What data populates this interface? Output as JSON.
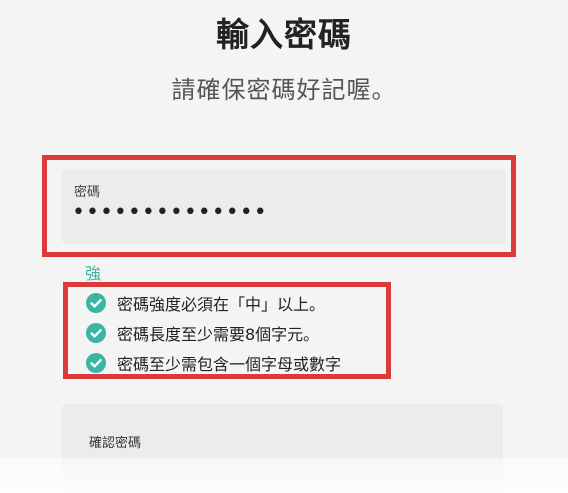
{
  "header": {
    "title": "輸入密碼",
    "subtitle": "請確保密碼好記喔。"
  },
  "password_field": {
    "label": "密碼",
    "value": "••••••••••••••"
  },
  "strength": {
    "label": "強",
    "color": "#3ab5a4"
  },
  "requirements": [
    {
      "text": "密碼強度必須在「中」以上。",
      "icon": "check-circle-icon",
      "met": true
    },
    {
      "text": "密碼長度至少需要8個字元。",
      "icon": "check-circle-icon",
      "met": true
    },
    {
      "text": "密碼至少需包含一個字母或數字",
      "icon": "check-circle-icon",
      "met": true
    }
  ],
  "confirm_field": {
    "label": "確認密碼",
    "value": ""
  },
  "colors": {
    "highlight": "#d93a3a",
    "check": "#3ab5a4",
    "field_bg": "#ececec",
    "page_bg": "#f4f4f4"
  }
}
